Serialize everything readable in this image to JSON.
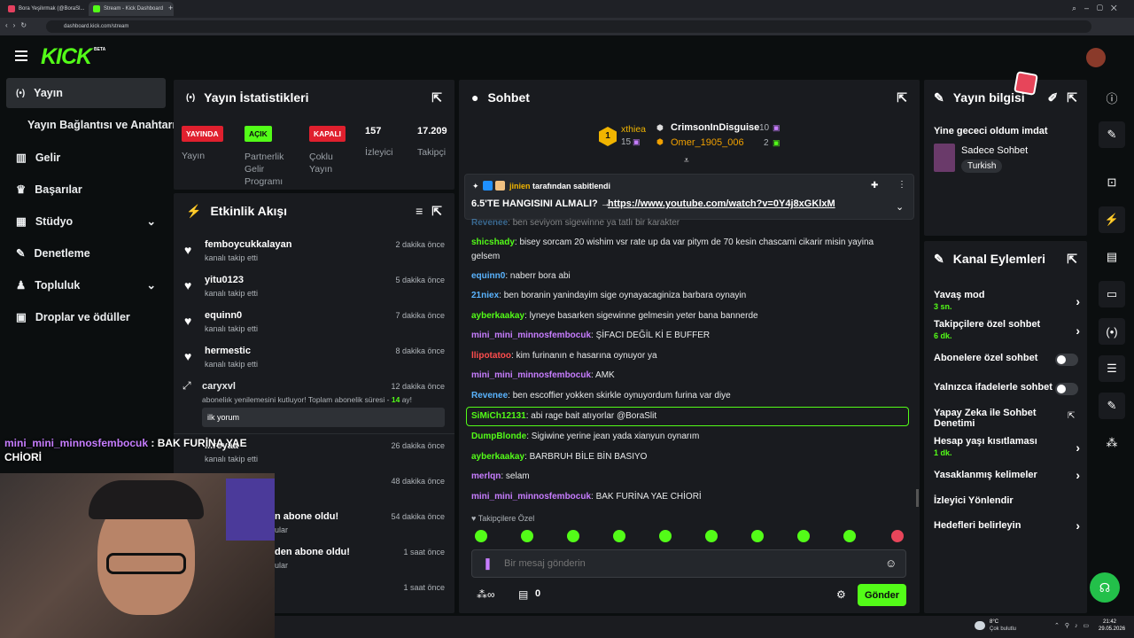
{
  "browser": {
    "tabs": [
      {
        "title": "Bora Yeşilırmak (@BoraSl...",
        "color": "#e4405f"
      },
      {
        "title": "Stream - Kick Dashboard",
        "color": "#53fc18"
      }
    ],
    "url": "dashboard.kick.com/stream"
  },
  "brand": {
    "logo": "KICK",
    "beta": "BETA",
    "accent": "#53fc18"
  },
  "sidebar": {
    "items": [
      {
        "label": "Yayın",
        "icon": "broadcast-icon"
      },
      {
        "label": "Yayın Bağlantısı ve Anahtarı",
        "icon": ""
      },
      {
        "label": "Gelir",
        "icon": "chart-icon"
      },
      {
        "label": "Başarılar",
        "icon": "trophy-icon"
      },
      {
        "label": "Stüdyo",
        "icon": "studio-icon"
      },
      {
        "label": "Denetleme",
        "icon": "wrench-icon"
      },
      {
        "label": "Topluluk",
        "icon": "community-icon"
      },
      {
        "label": "Droplar ve ödüller",
        "icon": "gift-icon"
      }
    ]
  },
  "stats": {
    "title": "Yayın İstatistikleri",
    "badges": [
      {
        "text": "YAYINDA",
        "label": "Yayın",
        "color": "#e0202e"
      },
      {
        "text": "AÇIK",
        "label": "Partnerlik Gelir Programı",
        "color": "#53fc18"
      },
      {
        "text": "KAPALI",
        "label": "Çoklu Yayın",
        "color": "#e0202e"
      }
    ],
    "viewers": "157",
    "viewers_label": "İzleyici",
    "followers": "17.209",
    "followers_label": "Takipçi"
  },
  "activity": {
    "title": "Etkinlik Akışı",
    "events": [
      {
        "name": "femboycukkalayan",
        "sub": "kanalı takip etti",
        "time": "2 dakika önce"
      },
      {
        "name": "yitu0123",
        "sub": "kanalı takip etti",
        "time": "5 dakika önce"
      },
      {
        "name": "equinn0",
        "sub": "kanalı takip etti",
        "time": "7 dakika önce"
      },
      {
        "name": "hermestic",
        "sub": "kanalı takip etti",
        "time": "8 dakika önce"
      }
    ],
    "sub_event": {
      "name": "caryxvl",
      "time": "12 dakika önce",
      "text": "aboneliık yenilemesini kutluyor! Toplam abonelik süresi - ",
      "months": "14",
      "months_suffix": " ay!",
      "comment": "ilk yorum"
    },
    "partial": [
      {
        "name": "...reyaa",
        "sub": "kanalı takip etti",
        "time": "26 dakika önce"
      },
      {
        "name": "",
        "sub": "",
        "time": "48 dakika önce"
      },
      {
        "name": "n abone oldu!",
        "sub": "ular",
        "time": "54 dakika önce"
      },
      {
        "name": "den abone oldu!",
        "sub": "ular",
        "time": "1 saat önce"
      },
      {
        "name": "",
        "sub": "",
        "time": "1 saat önce"
      }
    ]
  },
  "overlay": {
    "user": "mini_mini_minnosfembocuk",
    "text": " : BAK FURİNA YAE",
    "text2": "CHİORİ"
  },
  "chat": {
    "title": "Sohbet",
    "top": [
      {
        "rank": "1",
        "name": "xthiea",
        "count": "15"
      },
      {
        "name": "CrimsonInDisguise",
        "count": "10"
      },
      {
        "name": "Omer_1905_006",
        "count": "2"
      }
    ],
    "pinned_by_prefix": "jinien",
    "pinned_by_suffix": " tarafından sabitlendi",
    "pinned_text": "6.5'TE HANGISINI ALMALI? →",
    "pinned_link": "https://www.youtube.com/watch?v=0Y4j8xGKlxM",
    "messages": [
      {
        "user": "Revenee",
        "color": "#5ab4ff",
        "text": "ben seviyom sigewinne ya tatlı bir karakter"
      },
      {
        "user": "shicshady",
        "color": "#53fc18",
        "text": "bisey sorcam 20 wishim vsr rate up da var pitym de 70 kesin chascami cikarir misin yayina"
      },
      {
        "user": "",
        "color": "#e8eaeb",
        "text": "gelsem"
      },
      {
        "user": "equinn0",
        "color": "#5ab4ff",
        "text": "naberr bora abi"
      },
      {
        "user": "21niex",
        "color": "#5ab4ff",
        "text": "ben boranin yanindayim sige oynayacaginiza barbara oynayin"
      },
      {
        "user": "ayberkaakay",
        "color": "#53fc18",
        "text": "lyneye basarken sigewinne gelmesin yeter bana bannerde"
      },
      {
        "user": "mini_mini_minnosfembocuk",
        "color": "#c77dff",
        "text": "ŞİFACI DEĞİL Kİ E BUFFER"
      },
      {
        "user": "llipotatoo",
        "color": "#ff4d4d",
        "text": "kim furinanın e hasarına oynuyor ya"
      },
      {
        "user": "mini_mini_minnosfembocuk",
        "color": "#c77dff",
        "text": "AMK"
      },
      {
        "user": "Revenee",
        "color": "#5ab4ff",
        "text": "ben escoffier yokken skirkle oynuyordum furina var diye"
      },
      {
        "user": "SiMiCh12131",
        "color": "#53fc18",
        "text": "abi rage bait atıyorlar @BoraSlit"
      },
      {
        "user": "DumpBlonde",
        "color": "#53fc18",
        "text": "Sigiwine yerine jean yada xianyun oynarım"
      },
      {
        "user": "ayberkaakay",
        "color": "#53fc18",
        "text": "BARBRUH BİLE BİN BASIYO"
      },
      {
        "user": "merlqn",
        "color": "#c77dff",
        "text": "selam"
      },
      {
        "user": "mini_mini_minnosfembocuk",
        "color": "#c77dff",
        "text": "BAK FURİNA YAE CHİORİ"
      }
    ],
    "followers_only": "Takipçilere Özel",
    "input_placeholder": "Bir mesaj gönderin",
    "coins": "0",
    "send": "Gönder"
  },
  "stream_info": {
    "title": "Yayın bilgisi",
    "stream_title": "Yine gececi oldum imdat",
    "category": "Sadece Sohbet",
    "tag": "Turkish"
  },
  "channel_actions": {
    "title": "Kanal Eylemleri",
    "items": [
      {
        "label": "Yavaş mod",
        "sub": "3 sn.",
        "control": "chevron"
      },
      {
        "label": "Takipçilere özel sohbet",
        "sub": "6 dk.",
        "control": "chevron"
      },
      {
        "label": "Abonelere özel sohbet",
        "sub": "",
        "control": "toggle"
      },
      {
        "label": "Yalnızca ifadelerle sohbet",
        "sub": "",
        "control": "toggle"
      },
      {
        "label": "Yapay Zeka ile Sohbet Denetimi",
        "sub": "",
        "control": "external"
      },
      {
        "label": "Hesap yaşı kısıtlaması",
        "sub": "1 dk.",
        "control": "chevron"
      },
      {
        "label": "Yasaklanmış kelimeler",
        "sub": "",
        "control": "chevron"
      },
      {
        "label": "İzleyici Yönlendir",
        "sub": "",
        "control": "none"
      },
      {
        "label": "Hedefleri belirleyin",
        "sub": "",
        "control": "chevron"
      }
    ]
  },
  "taskbar": {
    "weather": "8°C",
    "weather_desc": "Çok bulutlu",
    "time": "21:42",
    "date": "29.05.2026"
  }
}
